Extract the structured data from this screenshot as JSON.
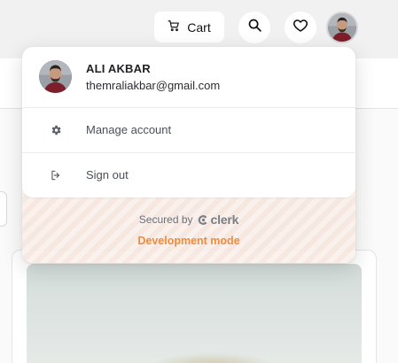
{
  "header": {
    "cart_label": "Cart"
  },
  "user": {
    "name": "ALI AKBAR",
    "email": "themraliakbar@gmail.com"
  },
  "menu": {
    "manage_account": "Manage account",
    "sign_out": "Sign out"
  },
  "footer": {
    "secured_by": "Secured by",
    "brand": "clerk",
    "dev_mode": "Development mode"
  },
  "icons": {
    "cart": "cart-icon",
    "search": "search-icon",
    "wishlist": "heart-icon",
    "manage": "gear-icon",
    "sign_out": "sign-out-icon",
    "brand": "clerk-logo-icon"
  },
  "colors": {
    "dev_mode": "#f08a3c",
    "footer_stripe": "#f6e6de"
  }
}
